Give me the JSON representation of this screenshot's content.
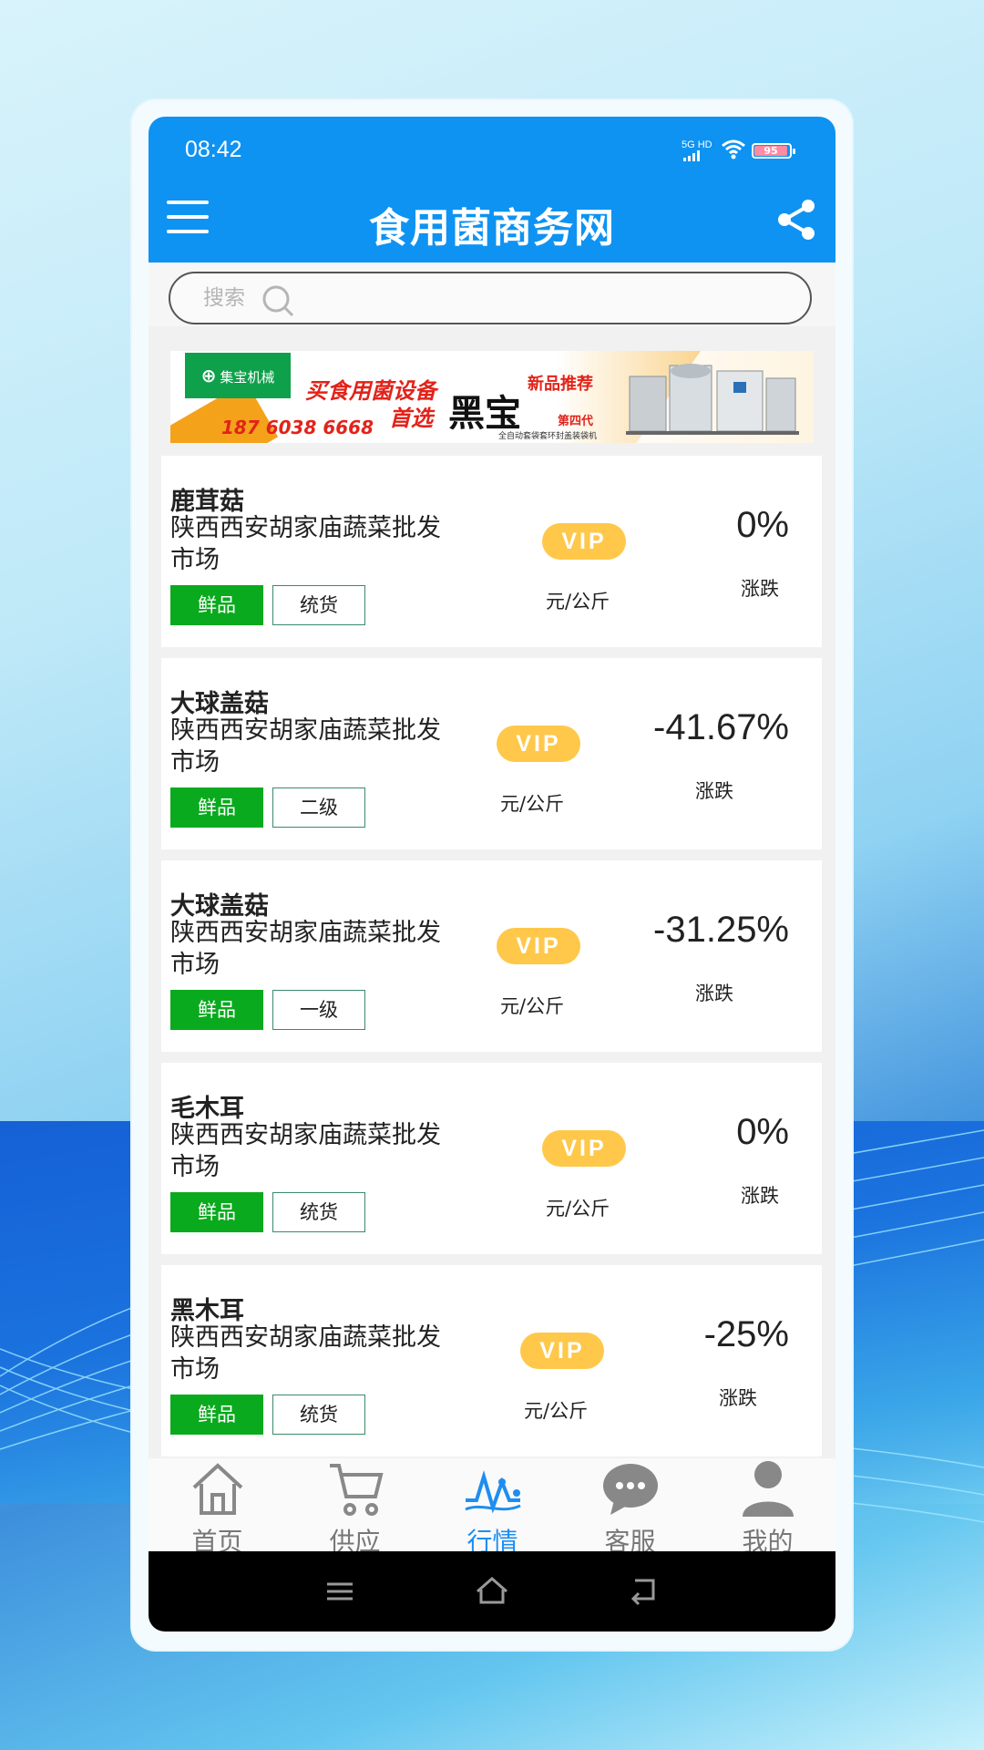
{
  "status": {
    "time": "08:42",
    "network": "5G HD",
    "battery": "95"
  },
  "header": {
    "title": "食用菌商务网"
  },
  "search": {
    "placeholder": "搜索"
  },
  "banner": {
    "brand": "集宝机械",
    "phone": "187 6038 6668",
    "slogan_line1": "买食用菌设备",
    "slogan_line2": "首选",
    "slogan_brand": "黑宝",
    "new_tag": "新品推荐",
    "generation": "第四代",
    "desc": "全自动套袋套环封盖装袋机"
  },
  "listings": [
    {
      "name": "鹿茸菇",
      "market": "陕西西安胡家庙蔬菜批发市场",
      "category": "鲜品",
      "grade": "统货",
      "price": "VIP",
      "unit": "元/公斤",
      "change": "0%",
      "change_label": "涨跌"
    },
    {
      "name": "大球盖菇",
      "market": "陕西西安胡家庙蔬菜批发市场",
      "category": "鲜品",
      "grade": "二级",
      "price": "VIP",
      "unit": "元/公斤",
      "change": "-41.67%",
      "change_label": "涨跌"
    },
    {
      "name": "大球盖菇",
      "market": "陕西西安胡家庙蔬菜批发市场",
      "category": "鲜品",
      "grade": "一级",
      "price": "VIP",
      "unit": "元/公斤",
      "change": "-31.25%",
      "change_label": "涨跌"
    },
    {
      "name": "毛木耳",
      "market": "陕西西安胡家庙蔬菜批发市场",
      "category": "鲜品",
      "grade": "统货",
      "price": "VIP",
      "unit": "元/公斤",
      "change": "0%",
      "change_label": "涨跌"
    },
    {
      "name": "黑木耳",
      "market": "陕西西安胡家庙蔬菜批发市场",
      "category": "鲜品",
      "grade": "统货",
      "price": "VIP",
      "unit": "元/公斤",
      "change": "-25%",
      "change_label": "涨跌"
    }
  ],
  "tabs": [
    {
      "label": "首页",
      "icon": "home-icon"
    },
    {
      "label": "供应",
      "icon": "cart-icon"
    },
    {
      "label": "行情",
      "icon": "market-trend-icon",
      "active": true
    },
    {
      "label": "客服",
      "icon": "chat-icon"
    },
    {
      "label": "我的",
      "icon": "user-icon"
    }
  ],
  "colors": {
    "header": "#0e93f2",
    "accent_tab": "#1e8ef0",
    "fresh_tag": "#0aaa1e",
    "vip_badge": "#ffc84a"
  }
}
